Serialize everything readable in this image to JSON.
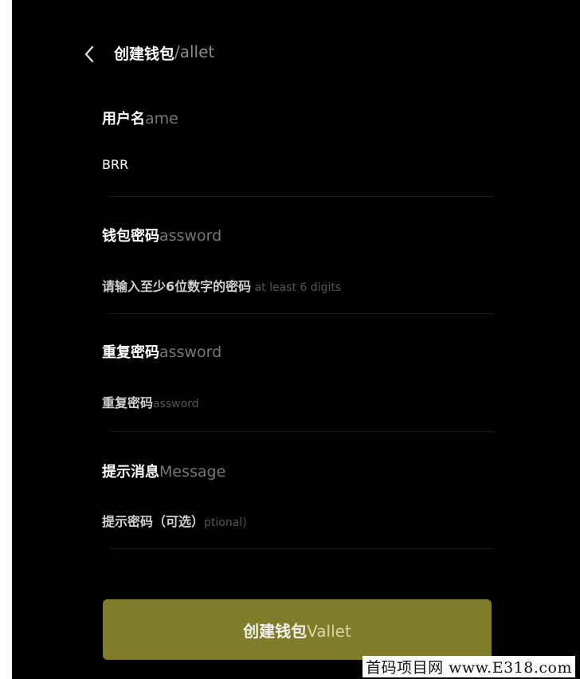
{
  "header": {
    "title_cn": "创建钱包",
    "title_en_tail": "/allet"
  },
  "fields": [
    {
      "label_cn": "用户名",
      "label_ghost": "ame",
      "value": "BRR"
    },
    {
      "label_cn": "钱包密码",
      "label_ghost": "assword",
      "placeholder_cn": "请输入至少6位数字的密码",
      "placeholder_ghost": " at least 6 digits"
    },
    {
      "label_cn": "重复密码",
      "label_ghost": "assword",
      "placeholder_cn": "重复密码",
      "placeholder_ghost": "assword"
    },
    {
      "label_cn": "提示消息",
      "label_ghost": "Message",
      "placeholder_cn": "提示密码（可选）",
      "placeholder_ghost": "ptional)"
    }
  ],
  "submit": {
    "label_cn": "创建钱包",
    "label_ghost": "Vallet"
  },
  "watermark": "首码项目网 www.E318.com",
  "colors": {
    "background": "#000000",
    "button": "#7f7d2a"
  }
}
